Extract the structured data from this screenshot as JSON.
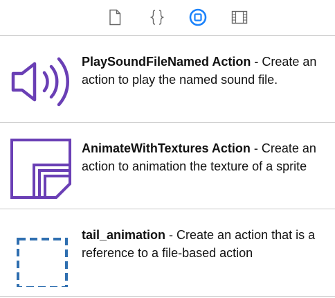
{
  "toolbar": {
    "tabs": [
      {
        "icon": "file-icon",
        "selected": false
      },
      {
        "icon": "braces-icon",
        "selected": false
      },
      {
        "icon": "object-library-icon",
        "selected": true
      },
      {
        "icon": "media-library-icon",
        "selected": false
      }
    ],
    "accent_color": "#1a82fb"
  },
  "library": {
    "items": [
      {
        "title": "PlaySoundFileNamed Action",
        "separator": " - ",
        "description": "Create an action to play the named sound file.",
        "icon": "speaker-icon",
        "icon_color": "#6a3fb5"
      },
      {
        "title": "AnimateWithTextures Action",
        "separator": " - ",
        "description": "Create an action to animation the texture of a sprite",
        "icon": "stacked-textures-icon",
        "icon_color": "#6a3fb5"
      },
      {
        "title": "tail_animation",
        "separator": " - ",
        "description": "Create an action that is a reference to a file-based action",
        "icon": "dashed-reference-icon",
        "icon_color": "#2f6fb0"
      }
    ]
  }
}
